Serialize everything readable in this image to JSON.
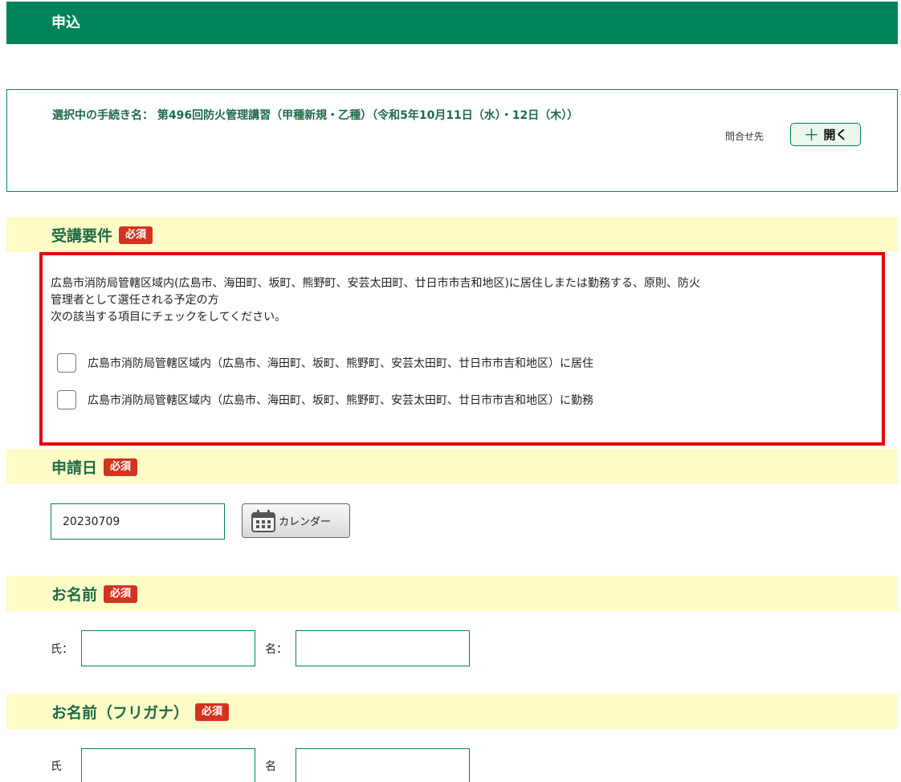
{
  "header": {
    "title": "申込"
  },
  "procedure": {
    "label": "選択中の手続き名：",
    "name": "第496回防火管理講習（甲種新規・乙種）（令和5年10月11日（水）・12日（木））",
    "inquiry_label": "問合せ先",
    "open_button": "開く"
  },
  "sections": {
    "requirement": {
      "title": "受講要件",
      "badge": "必須"
    },
    "application_date": {
      "title": "申請日",
      "badge": "必須"
    },
    "name": {
      "title": "お名前",
      "badge": "必須"
    },
    "furigana": {
      "title": "お名前（フリガナ）",
      "badge": "必須"
    }
  },
  "requirement": {
    "description_line1": "広島市消防局管轄区域内(広島市、海田町、坂町、熊野町、安芸太田町、廿日市市吉和地区)に居住しまたは勤務する、原則、防火",
    "description_line2": "管理者として選任される予定の方",
    "instruction": "次の該当する項目にチェックをしてください。",
    "options": [
      {
        "label": "広島市消防局管轄区域内（広島市、海田町、坂町、熊野町、安芸太田町、廿日市市吉和地区）に居住",
        "checked": false
      },
      {
        "label": "広島市消防局管轄区域内（広島市、海田町、坂町、熊野町、安芸太田町、廿日市市吉和地区）に勤務",
        "checked": false
      }
    ]
  },
  "application_date": {
    "value": "20230709",
    "calendar_button": "カレンダー"
  },
  "name": {
    "last_label": "氏：",
    "first_label": "名：",
    "last_value": "",
    "first_value": ""
  },
  "furigana": {
    "last_label": "氏",
    "first_label": "名",
    "last_value": "",
    "first_value": ""
  },
  "colors": {
    "header_green": "#00835a",
    "section_bg": "#fffcc8",
    "badge_red": "#d3331f",
    "highlight_red": "#e8000b"
  },
  "icons": {
    "open": "plus-icon",
    "calendar": "calendar-icon"
  }
}
